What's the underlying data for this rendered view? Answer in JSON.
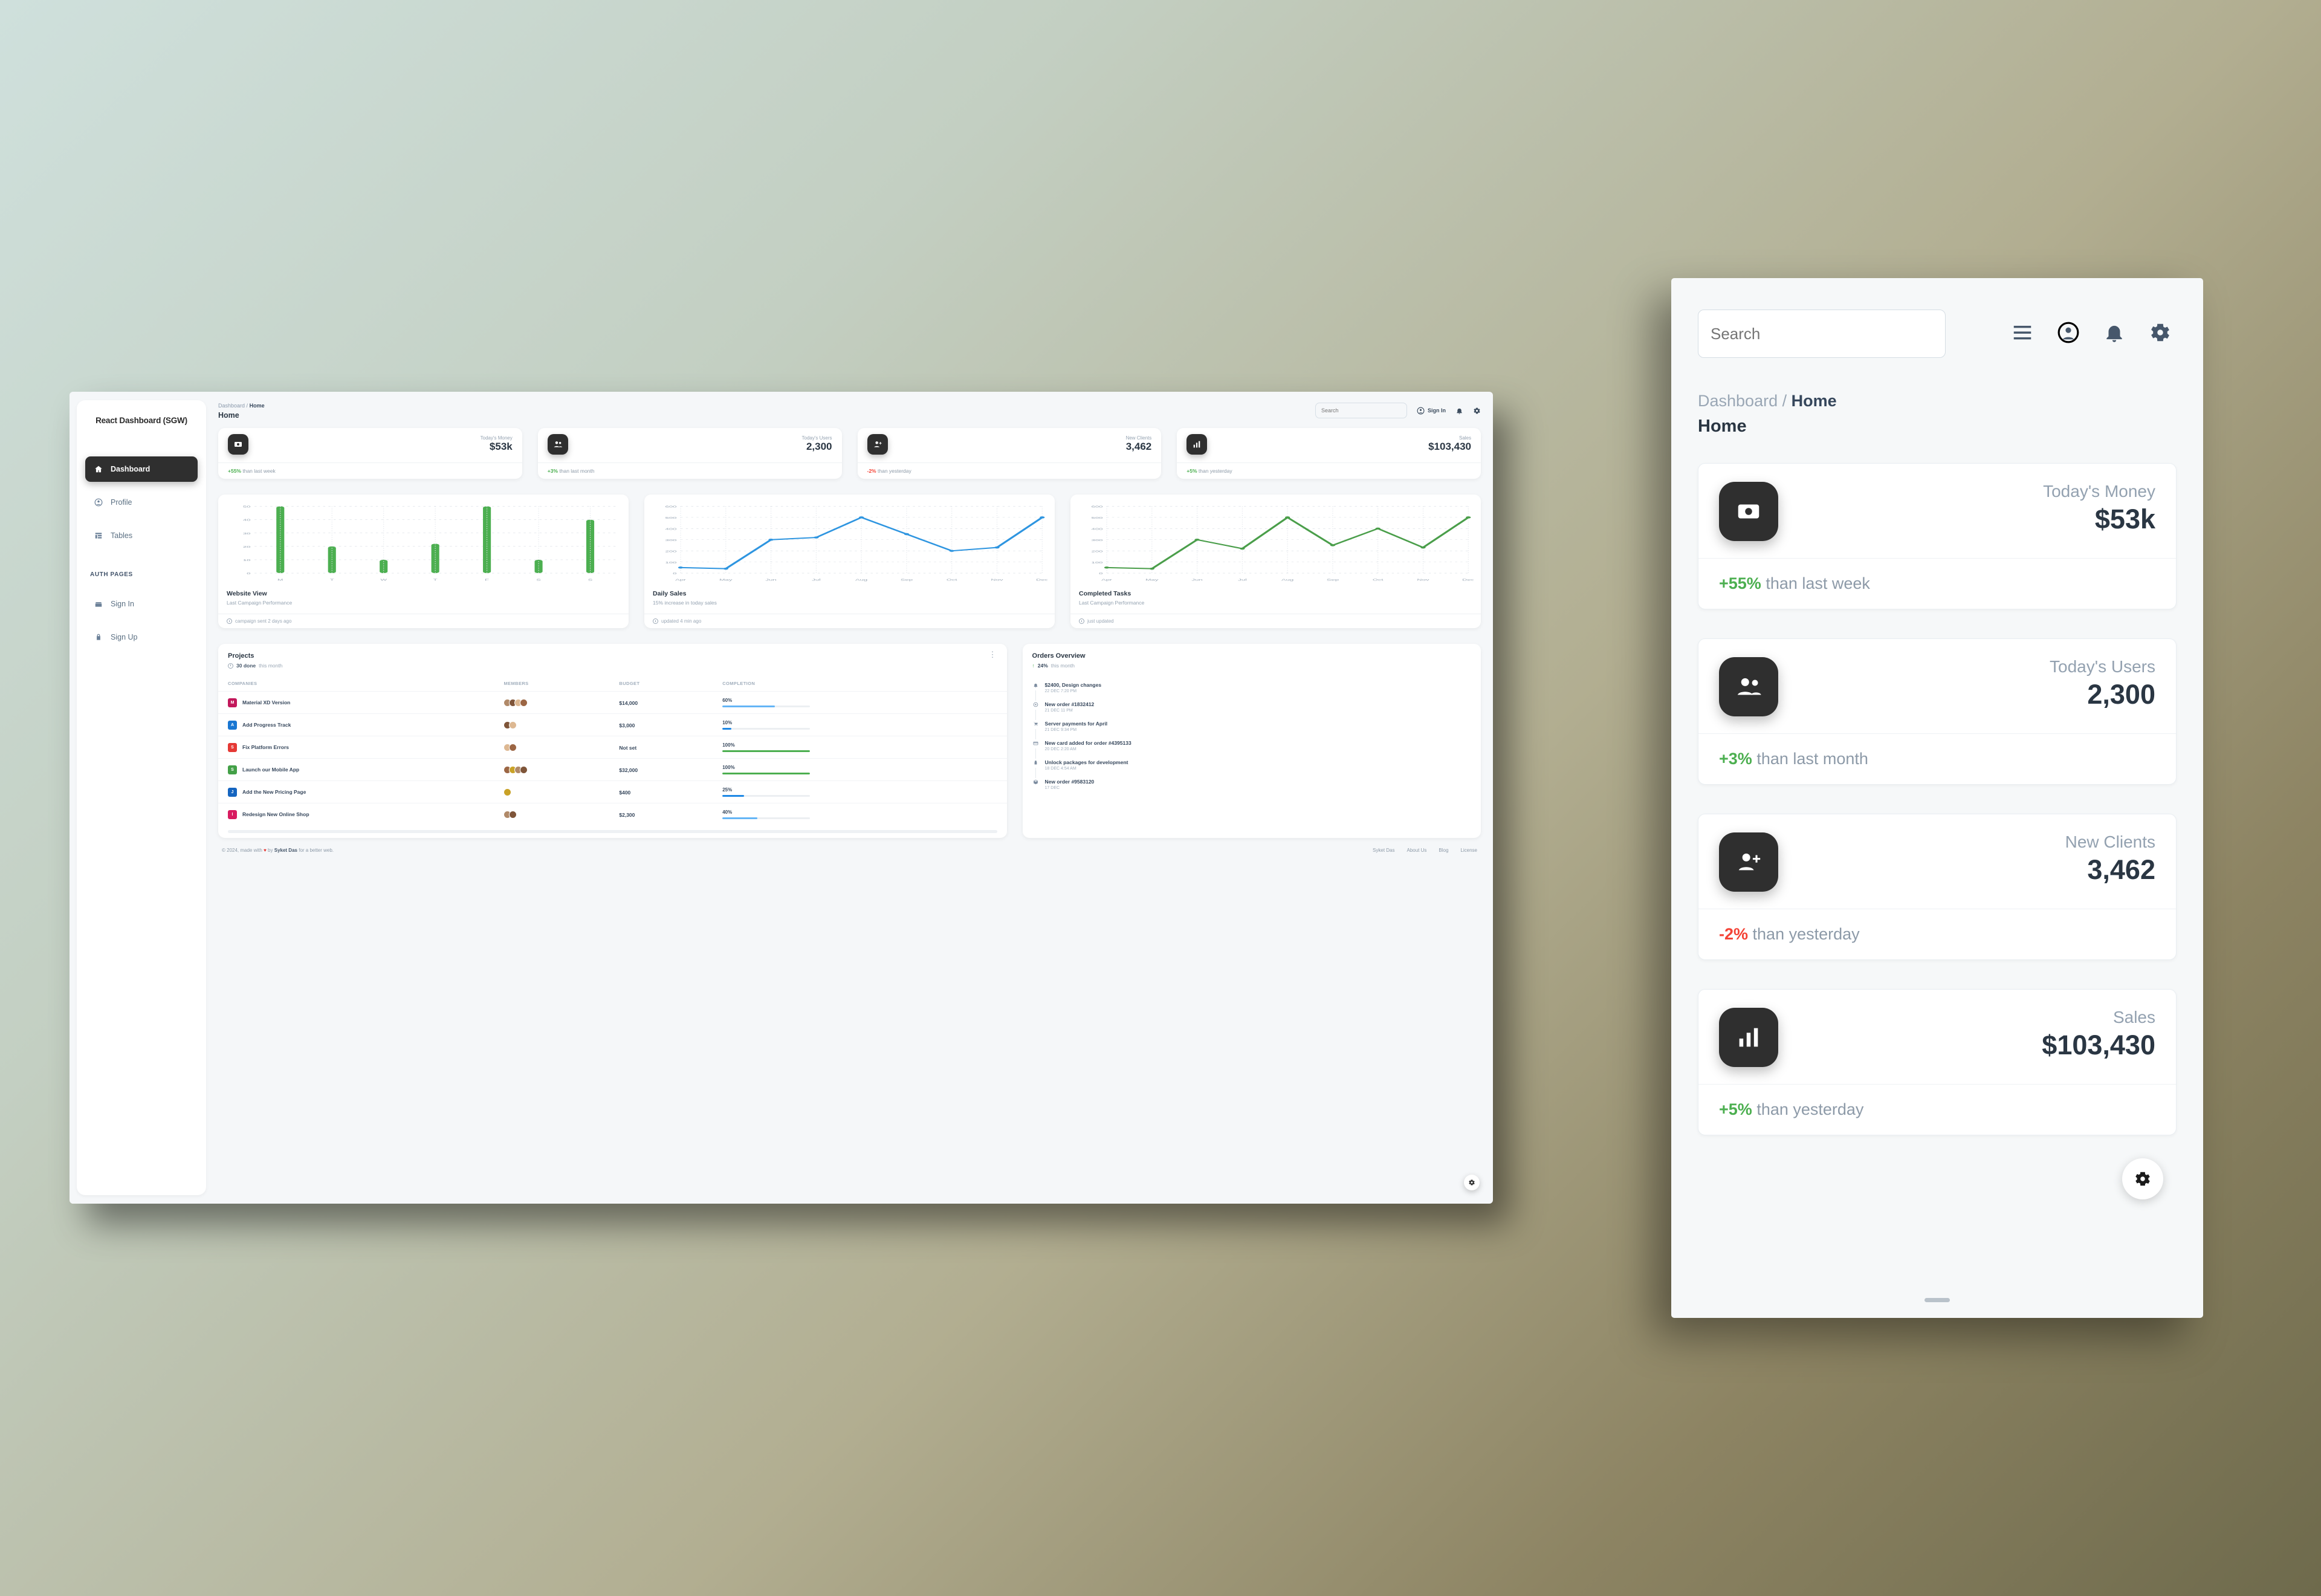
{
  "desktop": {
    "sidebar": {
      "brand": "React Dashboard (SGW)",
      "items": [
        {
          "label": "Dashboard",
          "icon": "home-icon",
          "active": true
        },
        {
          "label": "Profile",
          "icon": "person-icon",
          "active": false
        },
        {
          "label": "Tables",
          "icon": "table-icon",
          "active": false
        }
      ],
      "section_heading": "AUTH PAGES",
      "auth_items": [
        {
          "label": "Sign In",
          "icon": "login-icon"
        },
        {
          "label": "Sign Up",
          "icon": "lock-icon"
        }
      ]
    },
    "navbar": {
      "breadcrumb_root": "Dashboard",
      "breadcrumb_sep": "/",
      "breadcrumb_current": "Home",
      "page_title": "Home",
      "search_placeholder": "Search",
      "sign_in_label": "Sign In"
    },
    "stats": [
      {
        "label": "Today's Money",
        "value": "$53k",
        "delta": "+55%",
        "delta_dir": "up",
        "note": "than last week",
        "icon": "money-icon"
      },
      {
        "label": "Today's Users",
        "value": "2,300",
        "delta": "+3%",
        "delta_dir": "up",
        "note": "than last month",
        "icon": "users-icon"
      },
      {
        "label": "New Clients",
        "value": "3,462",
        "delta": "-2%",
        "delta_dir": "down",
        "note": "than yesterday",
        "icon": "person-add-icon"
      },
      {
        "label": "Sales",
        "value": "$103,430",
        "delta": "+5%",
        "delta_dir": "up",
        "note": "than yesterday",
        "icon": "bar-chart-icon"
      }
    ],
    "charts": [
      {
        "title": "Website View",
        "subtitle": "Last Campaign Performance",
        "footer": "campaign sent 2 days ago"
      },
      {
        "title": "Daily Sales",
        "subtitle": "15% increase in today sales",
        "footer": "updated 4 min ago"
      },
      {
        "title": "Completed Tasks",
        "subtitle": "Last Campaign Performance",
        "footer": "just updated"
      }
    ],
    "projects": {
      "title": "Projects",
      "subtitle_strong": "30 done",
      "subtitle_rest": "this month",
      "menu_icon": "more-vertical-icon",
      "columns": [
        "COMPANIES",
        "MEMBERS",
        "BUDGET",
        "COMPLETION"
      ],
      "rows": [
        {
          "name": "Material XD Version",
          "logo_color": "#c2185b",
          "logo_text": "M",
          "members": 4,
          "budget": "$14,000",
          "completion": "60%",
          "completion_pct": 60,
          "bar_color": "#64b5f6"
        },
        {
          "name": "Add Progress Track",
          "logo_color": "#1976d2",
          "logo_text": "A",
          "members": 2,
          "budget": "$3,000",
          "completion": "10%",
          "completion_pct": 10,
          "bar_color": "#1e88e5"
        },
        {
          "name": "Fix Platform Errors",
          "logo_color": "#e53935",
          "logo_text": "S",
          "members": 2,
          "budget": "Not set",
          "completion": "100%",
          "completion_pct": 100,
          "bar_color": "#4caf50"
        },
        {
          "name": "Launch our Mobile App",
          "logo_color": "#43a047",
          "logo_text": "S",
          "members": 4,
          "budget": "$32,000",
          "completion": "100%",
          "completion_pct": 100,
          "bar_color": "#4caf50"
        },
        {
          "name": "Add the New Pricing Page",
          "logo_color": "#1565c0",
          "logo_text": "J",
          "members": 1,
          "budget": "$400",
          "completion": "25%",
          "completion_pct": 25,
          "bar_color": "#1e88e5"
        },
        {
          "name": "Redesign New Online Shop",
          "logo_color": "#d81b60",
          "logo_text": "I",
          "members": 2,
          "budget": "$2,300",
          "completion": "40%",
          "completion_pct": 40,
          "bar_color": "#64b5f6"
        }
      ]
    },
    "orders": {
      "title": "Orders Overview",
      "subtitle_strong": "24%",
      "subtitle_rest": "this month",
      "items": [
        {
          "text": "$2400, Design changes",
          "time": "22 DEC 7:20 PM",
          "icon": "bell-icon"
        },
        {
          "text": "New order #1832412",
          "time": "21 DEC 11 PM",
          "icon": "code-icon"
        },
        {
          "text": "Server payments for April",
          "time": "21 DEC 9:34 PM",
          "icon": "cart-icon"
        },
        {
          "text": "New card added for order #4395133",
          "time": "20 DEC 2:20 AM",
          "icon": "credit-card-icon"
        },
        {
          "text": "Unlock packages for development",
          "time": "18 DEC 4:54 AM",
          "icon": "key-icon"
        },
        {
          "text": "New order #9583120",
          "time": "17 DEC",
          "icon": "package-icon"
        }
      ]
    },
    "footer": {
      "copyright_prefix": "© 2024, made with",
      "heart": "♥",
      "copyright_by": "by",
      "author": "Syket Das",
      "copyright_suffix": "for a better web.",
      "links": [
        "Syket Das",
        "About Us",
        "Blog",
        "License"
      ]
    }
  },
  "mobile": {
    "search_placeholder": "Search",
    "icons": [
      "menu-icon",
      "account-circle-icon",
      "bell-icon",
      "gear-icon"
    ],
    "breadcrumb_root": "Dashboard",
    "breadcrumb_sep": "/",
    "breadcrumb_current": "Home",
    "page_title": "Home",
    "stats": [
      {
        "label": "Today's Money",
        "value": "$53k",
        "delta": "+55%",
        "delta_dir": "up",
        "note": "than last week",
        "icon": "money-icon"
      },
      {
        "label": "Today's Users",
        "value": "2,300",
        "delta": "+3%",
        "delta_dir": "up",
        "note": "than last month",
        "icon": "users-icon"
      },
      {
        "label": "New Clients",
        "value": "3,462",
        "delta": "-2%",
        "delta_dir": "down",
        "note": "than yesterday",
        "icon": "person-add-icon"
      },
      {
        "label": "Sales",
        "value": "$103,430",
        "delta": "+5%",
        "delta_dir": "up",
        "note": "than yesterday",
        "icon": "bar-chart-icon"
      }
    ]
  },
  "chart_data": [
    {
      "type": "bar",
      "title": "Website View",
      "subtitle": "Last Campaign Performance",
      "categories": [
        "M",
        "T",
        "W",
        "T",
        "F",
        "S",
        "S"
      ],
      "values": [
        50,
        20,
        10,
        22,
        50,
        10,
        40
      ],
      "ylim": [
        0,
        50
      ],
      "yticks": [
        0,
        10,
        20,
        30,
        40,
        50
      ],
      "color": "#4caf50",
      "grid": true,
      "xlabel": "",
      "ylabel": ""
    },
    {
      "type": "line",
      "title": "Daily Sales",
      "subtitle": "15% increase in today sales",
      "categories": [
        "Apr",
        "May",
        "Jun",
        "Jul",
        "Aug",
        "Sep",
        "Oct",
        "Nov",
        "Dec"
      ],
      "values": [
        50,
        40,
        300,
        320,
        500,
        350,
        200,
        230,
        500
      ],
      "ylim": [
        0,
        600
      ],
      "yticks": [
        0,
        100,
        200,
        300,
        400,
        500,
        600
      ],
      "color": "#2e95e0",
      "grid": true,
      "xlabel": "",
      "ylabel": ""
    },
    {
      "type": "line",
      "title": "Completed Tasks",
      "subtitle": "Last Campaign Performance",
      "categories": [
        "Apr",
        "May",
        "Jun",
        "Jul",
        "Aug",
        "Sep",
        "Oct",
        "Nov",
        "Dec"
      ],
      "values": [
        50,
        40,
        300,
        220,
        500,
        250,
        400,
        230,
        500
      ],
      "ylim": [
        0,
        600
      ],
      "yticks": [
        0,
        100,
        200,
        300,
        400,
        500,
        600
      ],
      "color": "#4a9e4a",
      "grid": true,
      "xlabel": "",
      "ylabel": ""
    }
  ]
}
